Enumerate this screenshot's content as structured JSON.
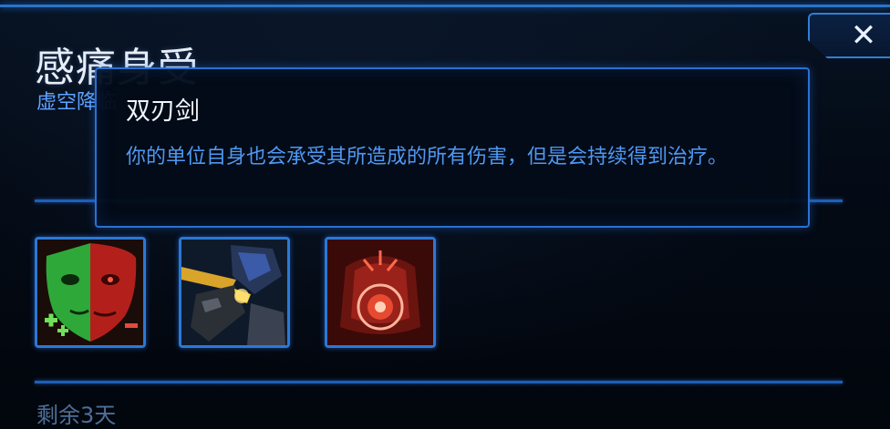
{
  "header": {
    "title": "感痛身受",
    "subtitle": "虚空降临",
    "close_icon": "✕"
  },
  "tooltip": {
    "title": "双刃剑",
    "description": "你的单位自身也会承受其所造成的所有伤害，但是会持续得到治疗。"
  },
  "abilities": [
    {
      "name": "double-edged-mask",
      "icon": "green-red-mask-icon",
      "selected": true
    },
    {
      "name": "gunner-unit",
      "icon": "gunner-icon",
      "selected": false
    },
    {
      "name": "red-blast",
      "icon": "red-explosion-icon",
      "selected": false
    }
  ],
  "footer": {
    "remaining_text": "剩余3天"
  },
  "colors": {
    "accent_blue": "#2c78d6",
    "desc_blue": "#4f98f2",
    "title_white": "#e8eef7"
  }
}
